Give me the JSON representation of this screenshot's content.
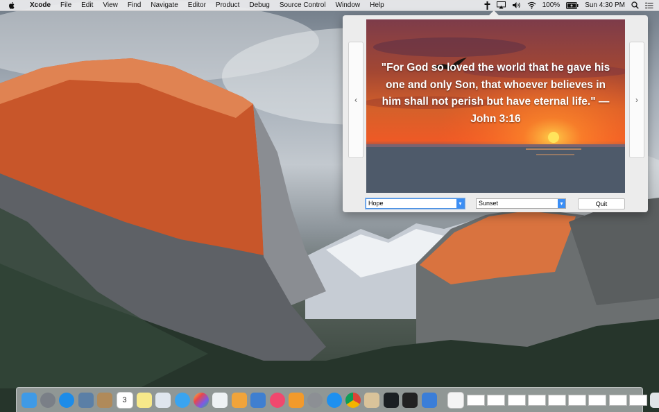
{
  "menubar": {
    "apple_icon": "apple-icon",
    "app_name": "Xcode",
    "items": [
      "File",
      "Edit",
      "View",
      "Find",
      "Navigate",
      "Editor",
      "Product",
      "Debug",
      "Source Control",
      "Window",
      "Help"
    ],
    "status": {
      "cross_icon": "cross-icon",
      "airplay_icon": "airplay-icon",
      "volume_icon": "volume-icon",
      "wifi_icon": "wifi-icon",
      "battery_percent": "100%",
      "battery_icon": "battery-charging-icon",
      "clock": "Sun 4:30 PM",
      "search_icon": "spotlight-search-icon",
      "list_icon": "notification-center-icon"
    }
  },
  "popover": {
    "prev_glyph": "‹",
    "next_glyph": "›",
    "verse": "\"For God so loved the world that he gave his one and only Son, that whoever believes in him shall not perish but have eternal life.\" — John 3:16",
    "topic_select": {
      "value": "Hope"
    },
    "theme_select": {
      "value": "Sunset"
    },
    "quit_label": "Quit"
  },
  "dock": {
    "calendar_day": "3",
    "colors": {
      "finder": "#3f9ae6",
      "launchpad": "#7a7f87",
      "safari": "#1d8ce8",
      "accent_select": "#3b8ef5"
    }
  }
}
